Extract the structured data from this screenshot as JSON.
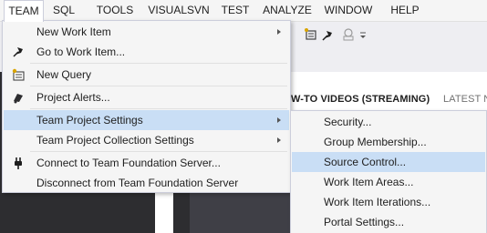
{
  "menubar": {
    "items": [
      "TEAM",
      "SQL",
      "TOOLS",
      "VISUALSVN",
      "TEST",
      "ANALYZE",
      "WINDOW",
      "HELP"
    ],
    "active": "TEAM"
  },
  "start_page": {
    "tab_videos": "W-TO VIDEOS (STREAMING)",
    "tab_latest": "LATEST N"
  },
  "team_menu": {
    "new_work_item": "New Work Item",
    "go_to_work_item": "Go to Work Item...",
    "new_query": "New Query",
    "project_alerts": "Project Alerts...",
    "team_project_settings": "Team Project Settings",
    "team_project_collection_settings": "Team Project Collection Settings",
    "connect_tfs": "Connect to Team Foundation Server...",
    "disconnect_tfs": "Disconnect from Team Foundation Server"
  },
  "settings_submenu": {
    "security": "Security...",
    "group_membership": "Group Membership...",
    "source_control": "Source Control...",
    "work_item_areas": "Work Item Areas...",
    "work_item_iterations": "Work Item Iterations...",
    "portal_settings": "Portal Settings..."
  },
  "colors": {
    "menu_bg": "#f5f5f5",
    "hover_bg": "#c9def5",
    "dark_bg": "#2d2d30"
  }
}
